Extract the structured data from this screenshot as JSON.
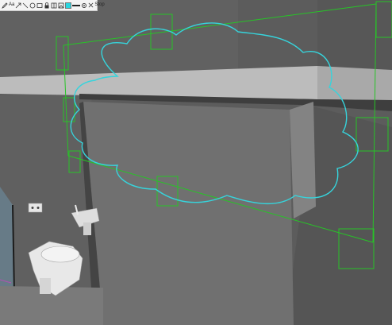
{
  "toolbar": {
    "tools": [
      {
        "name": "pencil-icon"
      },
      {
        "name": "text-tool-icon",
        "glyph": "Aa"
      },
      {
        "name": "arrow-icon"
      },
      {
        "name": "line-icon"
      },
      {
        "name": "ellipse-icon"
      },
      {
        "name": "rectangle-icon"
      },
      {
        "name": "lock-icon"
      },
      {
        "name": "split-view-icon"
      },
      {
        "name": "image-icon"
      }
    ],
    "color_swatch": "#2ad6e0",
    "line_weight": "medium",
    "stop_label": "Stop"
  },
  "markup": {
    "cloud_color": "#36d4dc",
    "box_color": "#27c427"
  },
  "scene": {
    "wall_color": "#5e5e5e",
    "beam_color": "#b9b9b9"
  }
}
